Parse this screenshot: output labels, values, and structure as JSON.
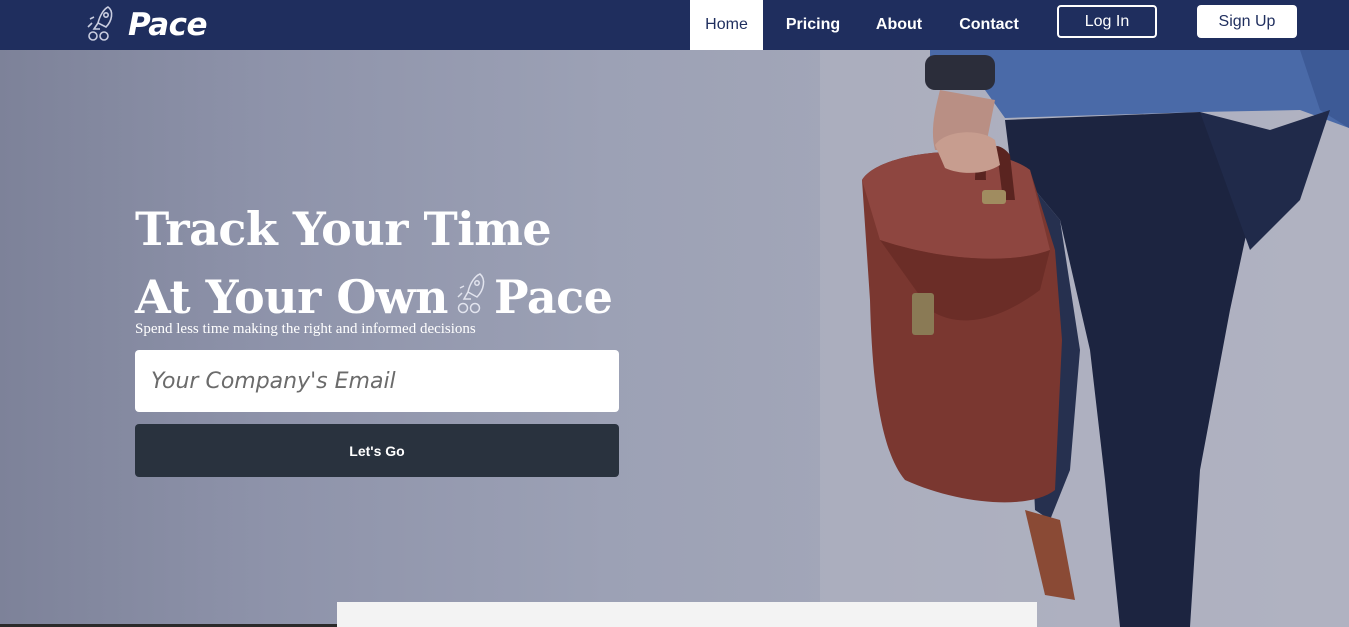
{
  "brand": {
    "name": "Pace",
    "icon": "rocket-icon"
  },
  "nav": {
    "items": [
      {
        "label": "Home",
        "active": true
      },
      {
        "label": "Pricing",
        "active": false
      },
      {
        "label": "About",
        "active": false
      },
      {
        "label": "Contact",
        "active": false
      }
    ],
    "login_label": "Log In",
    "signup_label": "Sign Up"
  },
  "hero": {
    "title_line1": "Track Your Time",
    "title_line2_pre": "At Your Own",
    "title_line2_post": "Pace",
    "subtitle": "Spend less time making the right and informed decisions",
    "email_placeholder": "Your Company's Email",
    "cta_label": "Let's Go"
  },
  "colors": {
    "navbar": "#1f2e5e",
    "cta_button": "#29323e",
    "hero_overlay": "#8e93aa"
  }
}
